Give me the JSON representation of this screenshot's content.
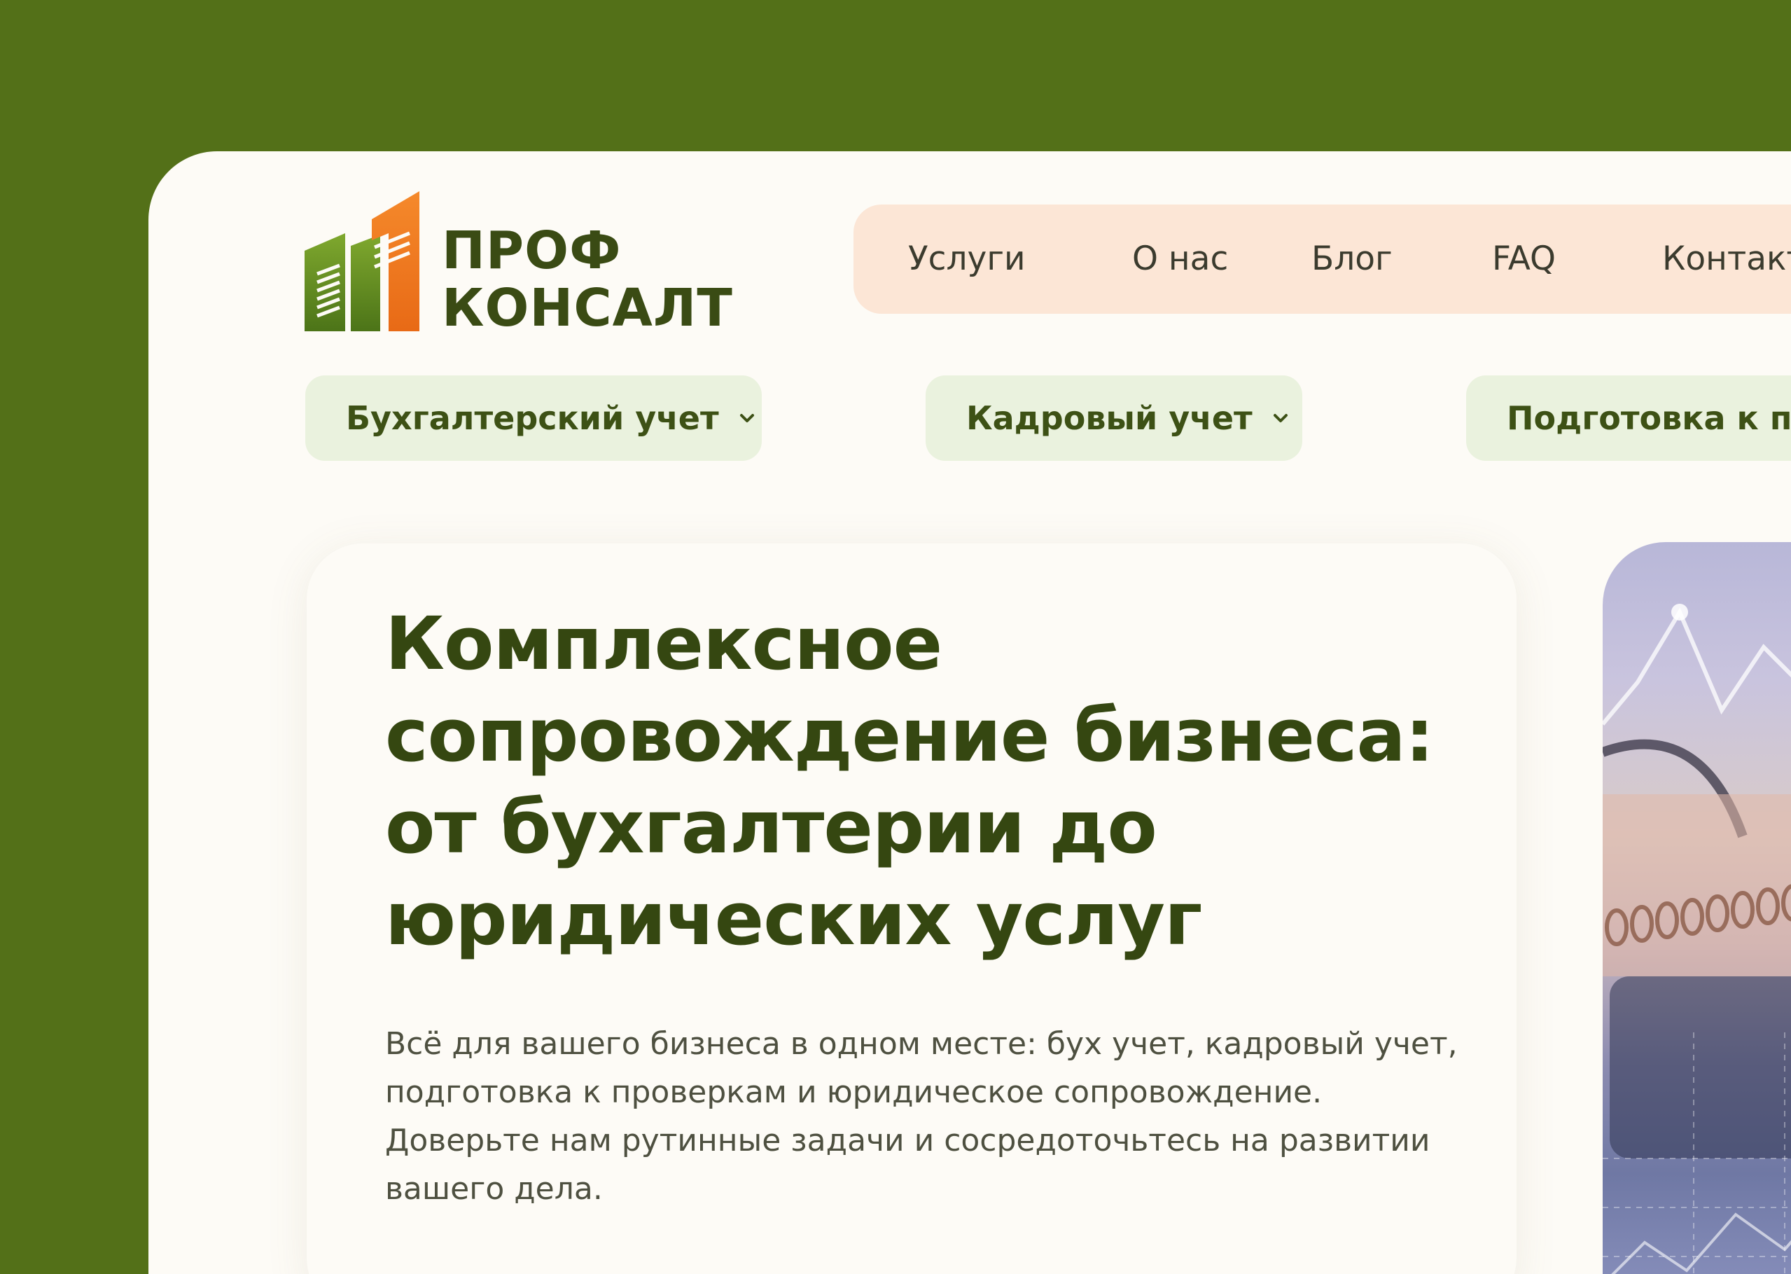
{
  "logo": {
    "line1": "ПРОФ",
    "line2": "КОНСАЛТ",
    "icon": "buildings-logo-icon",
    "colors": {
      "green": "#5E8A1E",
      "orange": "#F07A1F"
    }
  },
  "topnav": {
    "items": [
      {
        "label": "Услуги"
      },
      {
        "label": "О нас"
      },
      {
        "label": "Блог"
      },
      {
        "label": "FAQ"
      },
      {
        "label": "Контакты"
      }
    ]
  },
  "categories": [
    {
      "label": "Бухгалтерский учет",
      "icon": "chevron-down-icon"
    },
    {
      "label": "Кадровый учет",
      "icon": "chevron-down-icon"
    },
    {
      "label": "Подготовка к проверкам",
      "icon": "chevron-down-icon"
    }
  ],
  "hero": {
    "title": "Комплексное сопровождение бизнеса: от бухгалтерии до юридических услуг",
    "description": "Всё для вашего бизнеса в одном месте: бух учет, кадровый учет, подготовка к проверкам и юридическое сопровождение. Доверьте нам рутинные задачи и сосредоточьтесь на развитии вашего дела.",
    "image": "business-analytics-photo"
  },
  "colors": {
    "background": "#537018",
    "page": "#FDFBF6",
    "nav_bg": "#FCE6D6",
    "pill_bg": "#EAF2DE",
    "heading": "#354711"
  }
}
